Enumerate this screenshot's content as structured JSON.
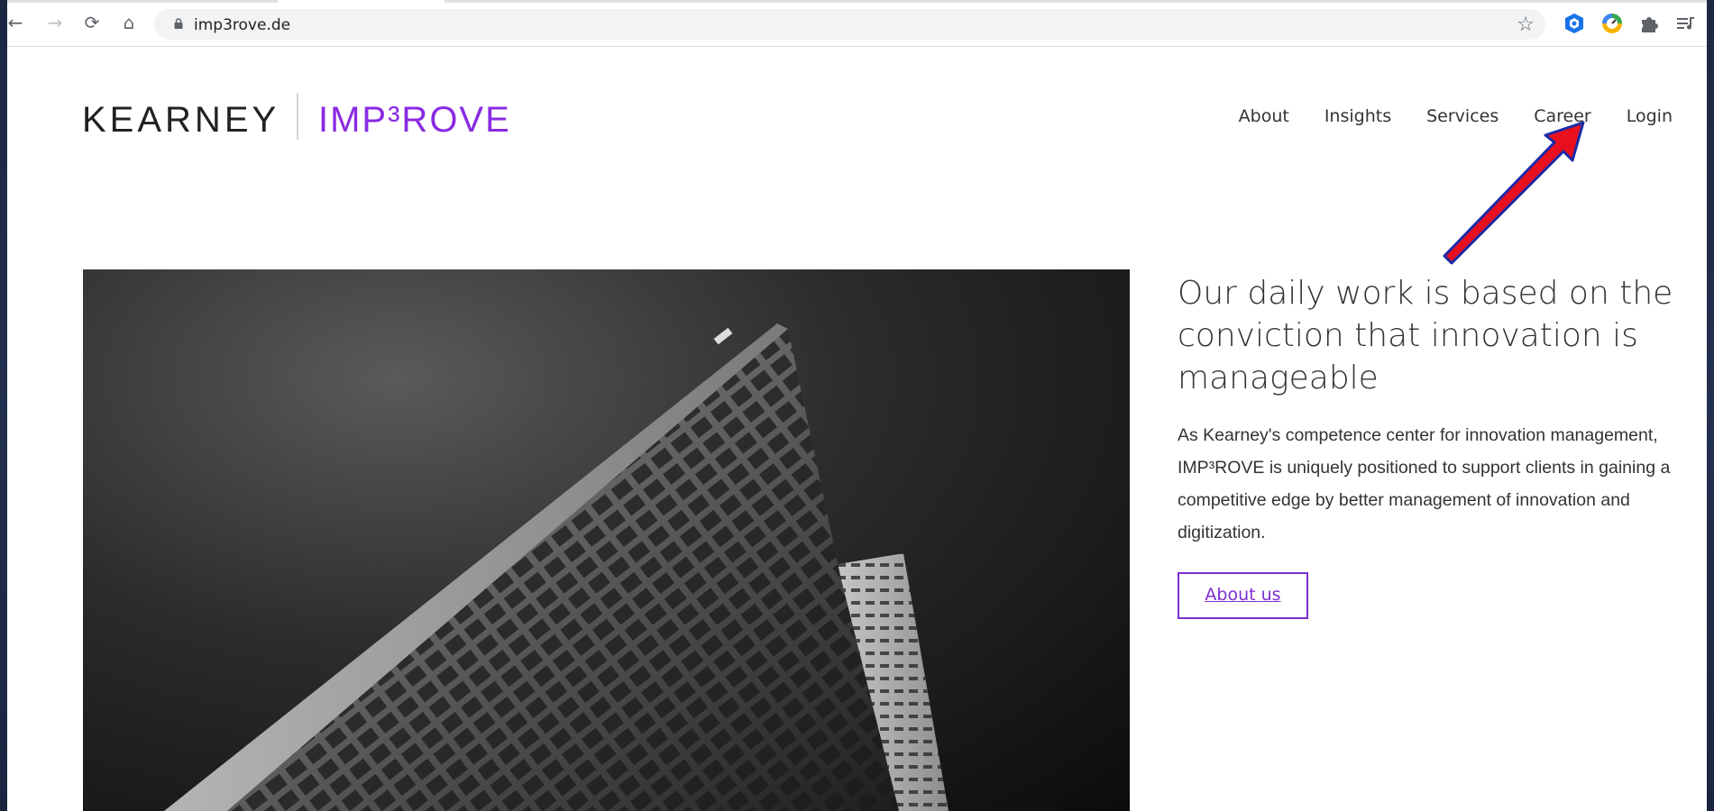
{
  "browser": {
    "url": "imp3rove.de",
    "buttons": {
      "back": "←",
      "forward": "→",
      "reload": "⟳",
      "home": "⌂",
      "bookmark": "☆"
    },
    "extension_icons": [
      "shield-extension-icon",
      "speedometer-extension-icon",
      "puzzle-extensions-icon",
      "media-control-icon"
    ]
  },
  "site": {
    "logo": {
      "kearney": "KEARNEY",
      "improve": "IMP³ROVE"
    },
    "nav": [
      "About",
      "Insights",
      "Services",
      "Career",
      "Login"
    ],
    "hero": {
      "title": "Our daily work is based on the conviction that innovation is manageable",
      "body": "As Kearney's competence center for innovation management, IMP³ROVE is uniquely positioned to support clients in gaining a competitive edge by better management of innovation and digitization.",
      "button": "About us"
    }
  },
  "colors": {
    "brand_purple": "#8a2be2",
    "annotation_arrow": "#e8101e",
    "annotation_outline": "#1b2aa8"
  }
}
